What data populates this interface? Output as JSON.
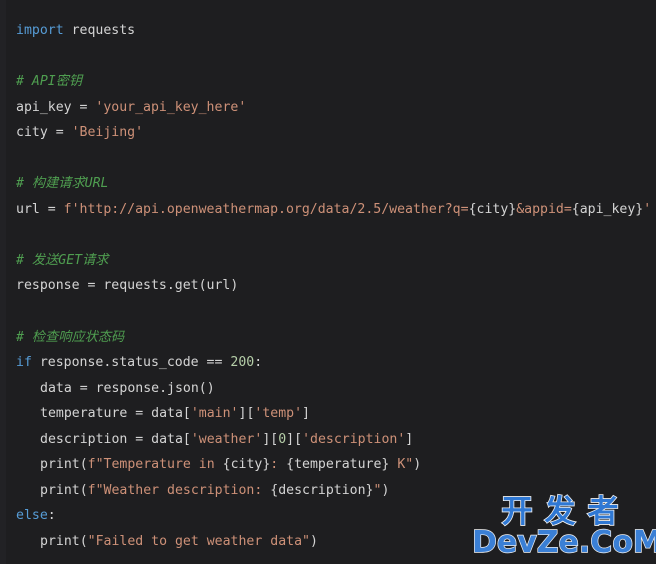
{
  "editor": {
    "background_color": "#1e1e20",
    "language": "python",
    "default_text_color": "#d4d4d4",
    "colors": {
      "keyword": "#569cd6",
      "string": "#ce9178",
      "comment": "#4f9e50",
      "number": "#b5cea8",
      "identifier": "#d4d4d4"
    }
  },
  "code": {
    "lines": [
      {
        "indent": 0,
        "tokens": [
          {
            "t": "import",
            "k": "kw"
          },
          {
            "t": " requests",
            "k": "plain"
          }
        ]
      },
      {
        "indent": 0,
        "tokens": []
      },
      {
        "indent": 0,
        "tokens": [
          {
            "t": "# API密钥",
            "k": "cmt"
          }
        ]
      },
      {
        "indent": 0,
        "tokens": [
          {
            "t": "api_key = ",
            "k": "plain"
          },
          {
            "t": "'your_api_key_here'",
            "k": "str"
          }
        ]
      },
      {
        "indent": 0,
        "tokens": [
          {
            "t": "city = ",
            "k": "plain"
          },
          {
            "t": "'Beijing'",
            "k": "str"
          }
        ]
      },
      {
        "indent": 0,
        "tokens": []
      },
      {
        "indent": 0,
        "tokens": [
          {
            "t": "# 构建请求URL",
            "k": "cmt"
          }
        ]
      },
      {
        "indent": 0,
        "tokens": [
          {
            "t": "url = ",
            "k": "plain"
          },
          {
            "t": "f'http://api.openweathermap.org/data/2.5/weather?q=",
            "k": "str"
          },
          {
            "t": "{city}",
            "k": "brace"
          },
          {
            "t": "&appid=",
            "k": "str"
          },
          {
            "t": "{api_key}",
            "k": "brace"
          },
          {
            "t": "'",
            "k": "str"
          }
        ]
      },
      {
        "indent": 0,
        "tokens": []
      },
      {
        "indent": 0,
        "tokens": [
          {
            "t": "# 发送GET请求",
            "k": "cmt"
          }
        ]
      },
      {
        "indent": 0,
        "tokens": [
          {
            "t": "response = requests.get(url)",
            "k": "plain"
          }
        ]
      },
      {
        "indent": 0,
        "tokens": []
      },
      {
        "indent": 0,
        "tokens": [
          {
            "t": "# 检查响应状态码",
            "k": "cmt"
          }
        ]
      },
      {
        "indent": 0,
        "tokens": [
          {
            "t": "if",
            "k": "kw"
          },
          {
            "t": " response.status_code == ",
            "k": "plain"
          },
          {
            "t": "200",
            "k": "num"
          },
          {
            "t": ":",
            "k": "plain"
          }
        ]
      },
      {
        "indent": 1,
        "tokens": [
          {
            "t": "data = response.json()",
            "k": "plain"
          }
        ]
      },
      {
        "indent": 1,
        "tokens": [
          {
            "t": "temperature = data[",
            "k": "plain"
          },
          {
            "t": "'main'",
            "k": "str"
          },
          {
            "t": "][",
            "k": "plain"
          },
          {
            "t": "'temp'",
            "k": "str"
          },
          {
            "t": "]",
            "k": "plain"
          }
        ]
      },
      {
        "indent": 1,
        "tokens": [
          {
            "t": "description = data[",
            "k": "plain"
          },
          {
            "t": "'weather'",
            "k": "str"
          },
          {
            "t": "][",
            "k": "plain"
          },
          {
            "t": "0",
            "k": "num"
          },
          {
            "t": "][",
            "k": "plain"
          },
          {
            "t": "'description'",
            "k": "str"
          },
          {
            "t": "]",
            "k": "plain"
          }
        ]
      },
      {
        "indent": 1,
        "tokens": [
          {
            "t": "print(",
            "k": "plain"
          },
          {
            "t": "f\"Temperature in ",
            "k": "str"
          },
          {
            "t": "{city}",
            "k": "brace"
          },
          {
            "t": ": ",
            "k": "str"
          },
          {
            "t": "{temperature}",
            "k": "brace"
          },
          {
            "t": " K\"",
            "k": "str"
          },
          {
            "t": ")",
            "k": "plain"
          }
        ]
      },
      {
        "indent": 1,
        "tokens": [
          {
            "t": "print(",
            "k": "plain"
          },
          {
            "t": "f\"Weather description: ",
            "k": "str"
          },
          {
            "t": "{description}",
            "k": "brace"
          },
          {
            "t": "\"",
            "k": "str"
          },
          {
            "t": ")",
            "k": "plain"
          }
        ]
      },
      {
        "indent": 0,
        "tokens": [
          {
            "t": "else",
            "k": "kw"
          },
          {
            "t": ":",
            "k": "plain"
          }
        ]
      },
      {
        "indent": 1,
        "tokens": [
          {
            "t": "print(",
            "k": "plain"
          },
          {
            "t": "\"Failed to get weather data\"",
            "k": "str"
          },
          {
            "t": ")",
            "k": "plain"
          }
        ]
      }
    ]
  },
  "watermark": {
    "chinese_text": "开发者",
    "site_text": "DevZe.CoM",
    "color": "#3a7fd5",
    "outline_color": "#f2f2f2"
  }
}
